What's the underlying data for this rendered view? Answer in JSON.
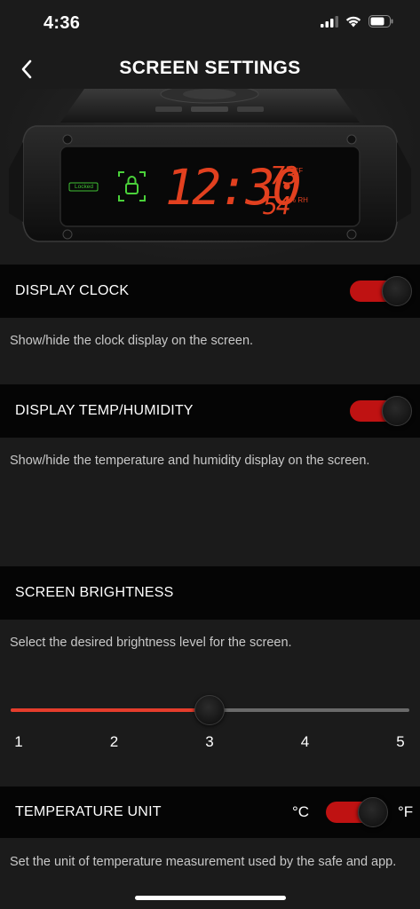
{
  "status": {
    "time": "4:36"
  },
  "nav": {
    "title": "SCREEN SETTINGS"
  },
  "hero": {
    "locked_label": "Locked",
    "clock": "12:30",
    "temp": "73",
    "temp_unit": "°F",
    "humidity": "54",
    "humidity_unit": "% RH",
    "display_color": "#e2401f",
    "lock_color": "#4ad13a"
  },
  "settings": {
    "display_clock": {
      "label": "DISPLAY CLOCK",
      "description": "Show/hide the clock display on the screen.",
      "enabled": true
    },
    "display_temp": {
      "label": "DISPLAY TEMP/HUMIDITY",
      "description": "Show/hide the temperature and humidity display on the screen.",
      "enabled": true
    },
    "brightness": {
      "label": "SCREEN BRIGHTNESS",
      "description": "Select the desired brightness level for the screen.",
      "levels": [
        "1",
        "2",
        "3",
        "4",
        "5"
      ],
      "value": 3,
      "min": 1,
      "max": 5
    },
    "temperature_unit": {
      "label": "TEMPERATURE UNIT",
      "celsius": "°C",
      "fahrenheit": "°F",
      "selected": "fahrenheit",
      "description": "Set the unit of temperature measurement used by the safe and app."
    }
  },
  "colors": {
    "accent": "#e53d2c",
    "toggle_on": "#bf1212",
    "background": "#1b1b1b",
    "row_background": "#050505"
  }
}
